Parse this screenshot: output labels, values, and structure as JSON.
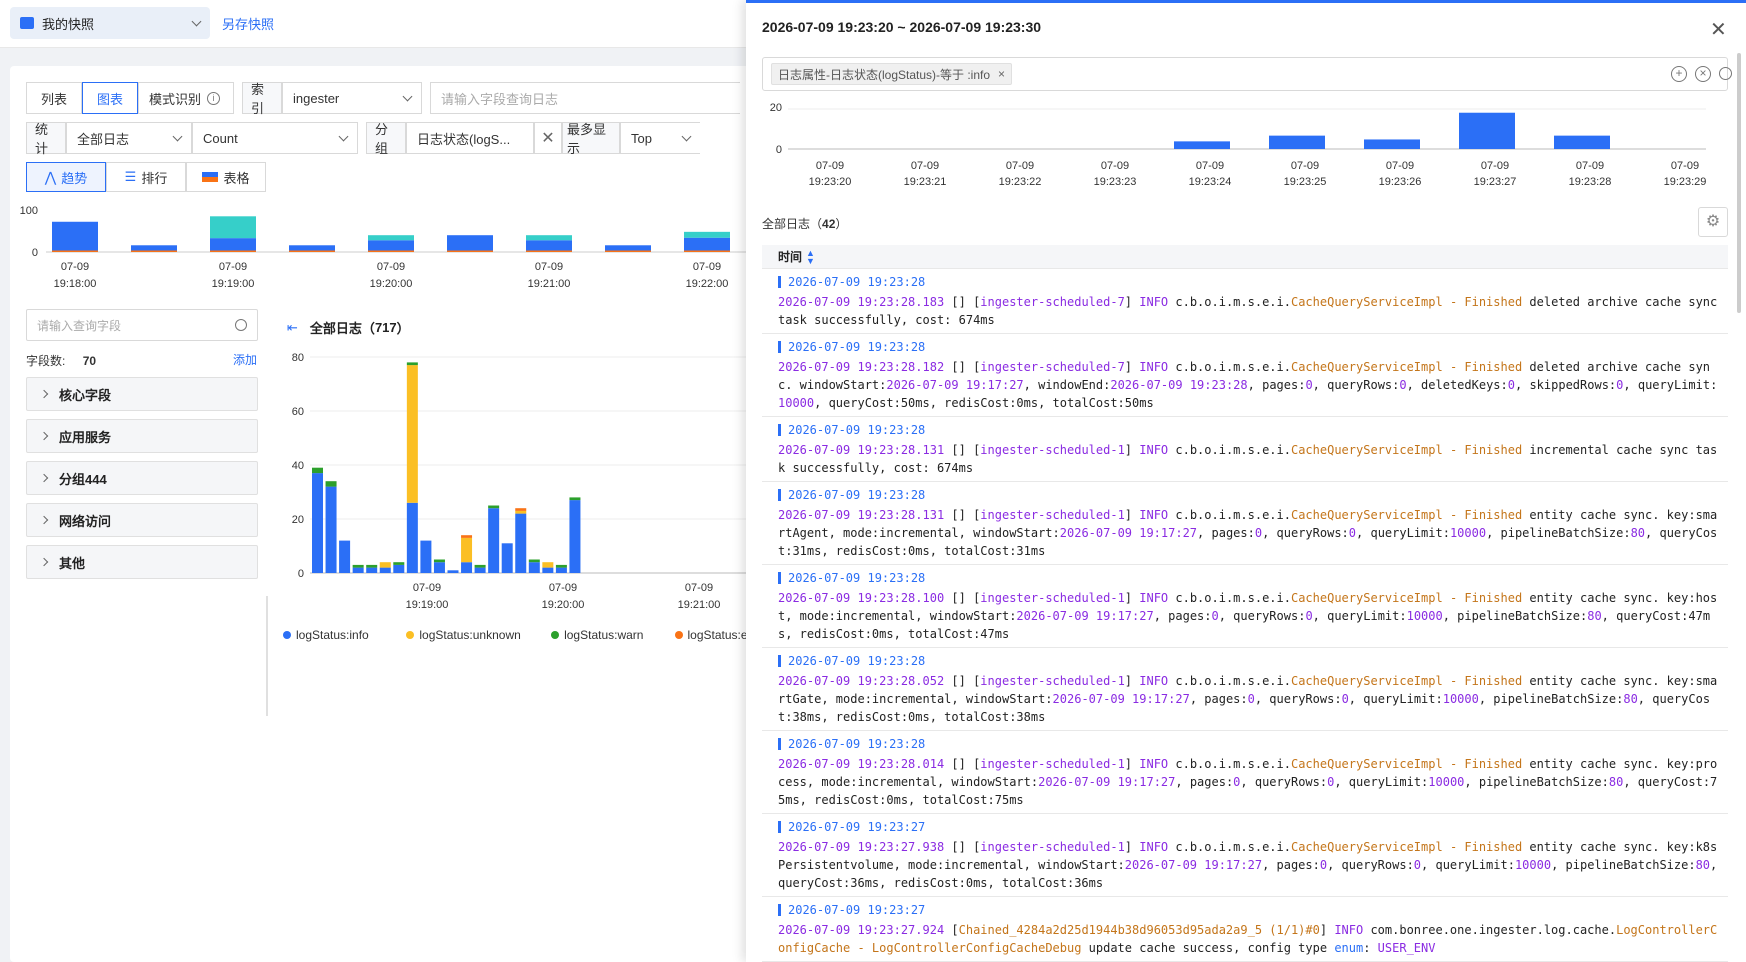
{
  "topbar": {
    "snapshot_label": "我的快照",
    "save_snapshot": "另存快照"
  },
  "toolbar": {
    "tab_list": "列表",
    "tab_chart": "图表",
    "tab_pattern": "模式识别",
    "index_label": "索引",
    "index_value": "ingester",
    "query_placeholder": "请输入字段查询日志",
    "stat_label": "统计",
    "stat_value": "全部日志",
    "metric_value": "Count",
    "group_label": "分组",
    "group_value": "日志状态(logS...",
    "max_label": "最多显示",
    "max_value": "Top",
    "view_trend": "趋势",
    "view_rank": "排行",
    "view_table": "表格"
  },
  "mini_chart": {
    "y_ticks": [
      "100",
      "0"
    ],
    "x_ticks": [
      [
        "07-09",
        "19:18:00"
      ],
      [
        "07-09",
        "19:19:00"
      ],
      [
        "07-09",
        "19:20:00"
      ],
      [
        "07-09",
        "19:21:00"
      ],
      [
        "07-09",
        "19:22:00"
      ]
    ],
    "values": [
      [
        72,
        0
      ],
      [
        16,
        0
      ],
      [
        33,
        52
      ],
      [
        16,
        0
      ],
      [
        28,
        12
      ],
      [
        40,
        0
      ],
      [
        28,
        12
      ],
      [
        16,
        0
      ],
      [
        34,
        14
      ]
    ]
  },
  "fields": {
    "search_placeholder": "请输入查询字段",
    "count_label": "字段数:",
    "count_value": "70",
    "add_label": "添加",
    "groups": [
      "核心字段",
      "应用服务",
      "分组444",
      "网络访问",
      "其他"
    ]
  },
  "main": {
    "all_logs_label": "全部日志",
    "all_logs_count": "717"
  },
  "chart_data": {
    "type": "bar",
    "stacked": true,
    "y_ticks": [
      "80",
      "60",
      "40",
      "20",
      "0"
    ],
    "ylim": [
      0,
      80
    ],
    "x_ticks": [
      [
        "07-09",
        "19:19:00"
      ],
      [
        "07-09",
        "19:20:00"
      ],
      [
        "07-09",
        "19:21:00"
      ]
    ],
    "series": [
      {
        "name": "logStatus:info",
        "color": "#2b6ff6",
        "values": [
          37,
          32,
          12,
          2,
          2,
          2,
          3,
          26,
          12,
          4,
          1,
          4,
          2,
          24,
          11,
          22,
          4,
          2,
          2,
          27
        ]
      },
      {
        "name": "logStatus:unknown",
        "color": "#fbbf24",
        "values": [
          0,
          0,
          0,
          0,
          0,
          2,
          0,
          51,
          0,
          0,
          0,
          9,
          0,
          0,
          0,
          1,
          0,
          2,
          0,
          0
        ]
      },
      {
        "name": "logStatus:warn",
        "color": "#2ca02c",
        "values": [
          2,
          2,
          0,
          1,
          1,
          0,
          1,
          1,
          0,
          1,
          0,
          0,
          1,
          1,
          0,
          0,
          1,
          0,
          1,
          1
        ]
      },
      {
        "name": "logStatus:error",
        "color": "#f97316",
        "values": [
          0,
          0,
          0,
          0,
          0,
          0,
          0,
          0,
          0,
          0,
          0,
          1,
          0,
          0,
          0,
          1,
          0,
          0,
          0,
          0
        ]
      }
    ]
  },
  "drawer": {
    "title": "2026-07-09 19:23:20 ~ 2026-07-09 19:23:30",
    "filter_chip": "日志属性-日志状态(logStatus)-等于 :info",
    "chart_y_ticks": [
      "20",
      "0"
    ],
    "chart_x_ticks": [
      [
        "07-09",
        "19:23:20"
      ],
      [
        "07-09",
        "19:23:21"
      ],
      [
        "07-09",
        "19:23:22"
      ],
      [
        "07-09",
        "19:23:23"
      ],
      [
        "07-09",
        "19:23:24"
      ],
      [
        "07-09",
        "19:23:25"
      ],
      [
        "07-09",
        "19:23:26"
      ],
      [
        "07-09",
        "19:23:27"
      ],
      [
        "07-09",
        "19:23:28"
      ],
      [
        "07-09",
        "19:23:29"
      ]
    ],
    "chart_values": [
      0,
      0,
      0,
      0,
      4,
      7,
      5,
      19,
      7,
      0
    ],
    "all_logs_label": "全部日志",
    "all_logs_count": "42",
    "col_time": "时间",
    "logs": [
      {
        "ts": "2026-07-09 19:23:28",
        "msg": "2026-07-09 19:23:28.183 [] [ingester-scheduled-7] INFO  c.b.o.i.m.s.e.i.CacheQueryServiceImpl - Finished deleted archive cache sync task successfully, cost: 674ms"
      },
      {
        "ts": "2026-07-09 19:23:28",
        "msg": "2026-07-09 19:23:28.182 [] [ingester-scheduled-7] INFO  c.b.o.i.m.s.e.i.CacheQueryServiceImpl - Finished deleted archive cache sync. windowStart:2026-07-09 19:17:27, windowEnd:2026-07-09 19:23:28, pages:0, queryRows:0, deletedKeys:0, skippedRows:0, queryLimit:10000, queryCost:50ms, redisCost:0ms, totalCost:50ms"
      },
      {
        "ts": "2026-07-09 19:23:28",
        "msg": "2026-07-09 19:23:28.131 [] [ingester-scheduled-1] INFO  c.b.o.i.m.s.e.i.CacheQueryServiceImpl - Finished incremental cache sync task successfully, cost: 674ms"
      },
      {
        "ts": "2026-07-09 19:23:28",
        "msg": "2026-07-09 19:23:28.131 [] [ingester-scheduled-1] INFO  c.b.o.i.m.s.e.i.CacheQueryServiceImpl - Finished entity cache sync. key:smartAgent, mode:incremental, windowStart:2026-07-09 19:17:27, pages:0, queryRows:0, queryLimit:10000, pipelineBatchSize:80, queryCost:31ms, redisCost:0ms, totalCost:31ms"
      },
      {
        "ts": "2026-07-09 19:23:28",
        "msg": "2026-07-09 19:23:28.100 [] [ingester-scheduled-1] INFO  c.b.o.i.m.s.e.i.CacheQueryServiceImpl - Finished entity cache sync. key:host, mode:incremental, windowStart:2026-07-09 19:17:27, pages:0, queryRows:0, queryLimit:10000, pipelineBatchSize:80, queryCost:47ms, redisCost:0ms, totalCost:47ms"
      },
      {
        "ts": "2026-07-09 19:23:28",
        "msg": "2026-07-09 19:23:28.052 [] [ingester-scheduled-1] INFO  c.b.o.i.m.s.e.i.CacheQueryServiceImpl - Finished entity cache sync. key:smartGate, mode:incremental, windowStart:2026-07-09 19:17:27, pages:0, queryRows:0, queryLimit:10000, pipelineBatchSize:80, queryCost:38ms, redisCost:0ms, totalCost:38ms"
      },
      {
        "ts": "2026-07-09 19:23:28",
        "msg": "2026-07-09 19:23:28.014 [] [ingester-scheduled-1] INFO  c.b.o.i.m.s.e.i.CacheQueryServiceImpl - Finished entity cache sync. key:process, mode:incremental, windowStart:2026-07-09 19:17:27, pages:0, queryRows:0, queryLimit:10000, pipelineBatchSize:80, queryCost:75ms, redisCost:0ms, totalCost:75ms"
      },
      {
        "ts": "2026-07-09 19:23:27",
        "msg": "2026-07-09 19:23:27.938 [] [ingester-scheduled-1] INFO  c.b.o.i.m.s.e.i.CacheQueryServiceImpl - Finished entity cache sync. key:k8sPersistentvolume, mode:incremental, windowStart:2026-07-09 19:17:27, pages:0, queryRows:0, queryLimit:10000, pipelineBatchSize:80, queryCost:36ms, redisCost:0ms, totalCost:36ms"
      },
      {
        "ts": "2026-07-09 19:23:27",
        "msg": "2026-07-09 19:23:27.924 [Chained_4284a2d25d1944b38d96053d95ada2a9_5 (1/1)#0] INFO  com.bonree.one.ingester.log.cache.LogControllerConfigCache  - LogControllerConfigCacheDebug update cache success, config type enum: USER_ENV"
      }
    ]
  }
}
